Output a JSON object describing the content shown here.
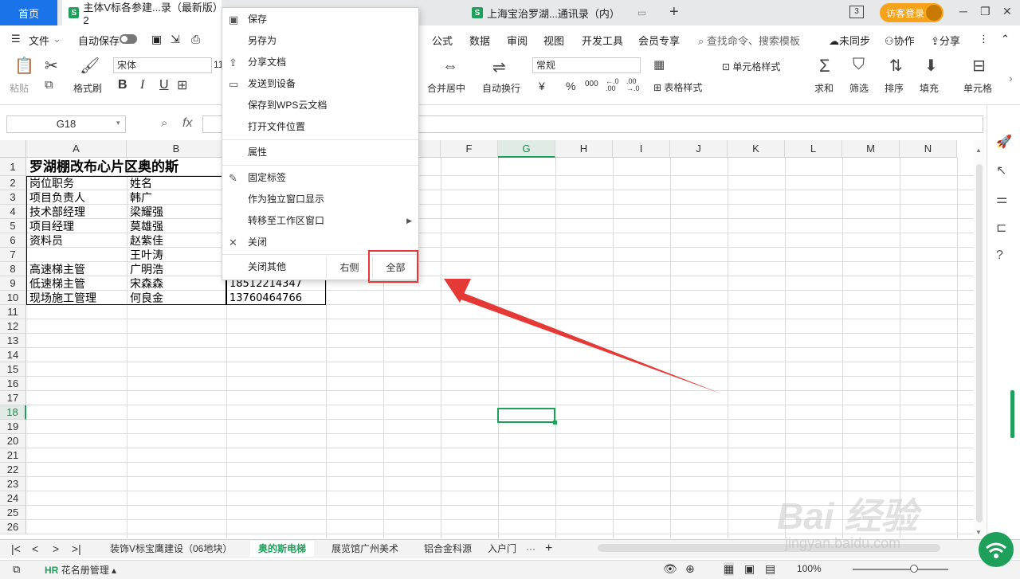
{
  "tabs": {
    "home": "首页",
    "doc1": "主体V标各参建...录（最新版）2",
    "doc2": "上海宝治罗湖...通讯录（内）",
    "new_tab": "+",
    "badge": "3",
    "visitor": "访客登录"
  },
  "menubar": {
    "file": "文件",
    "autosave": "自动保存",
    "items": [
      "公式",
      "数据",
      "审阅",
      "视图",
      "开发工具",
      "会员专享"
    ],
    "search": "查找命令、搜索模板",
    "unsync": "未同步",
    "collab": "协作",
    "share": "分享"
  },
  "ribbon": {
    "paste": "粘贴",
    "format_painter": "格式刷",
    "font_name": "宋体",
    "font_size": "11",
    "merge_center": "合并居中",
    "auto_wrap": "自动换行",
    "number_format": "常规",
    "cell_style": "单元格样式",
    "table_style": "表格样式",
    "sum": "求和",
    "filter": "筛选",
    "sort": "排序",
    "fill": "填充",
    "cell": "单元格",
    "bold": "B",
    "italic": "I",
    "underline": "U",
    "yuan": "¥",
    "percent": "%",
    "thousand": "000",
    "dec_inc": "←.0\n.00",
    "dec_dec": ".00\n→.0"
  },
  "formulabar": {
    "namebox": "G18",
    "fx": "fx",
    "content": ""
  },
  "grid": {
    "columns": [
      "A",
      "B",
      "C",
      "D",
      "E",
      "F",
      "G",
      "H",
      "I",
      "J",
      "K",
      "L",
      "M",
      "N"
    ],
    "rows": [
      "1",
      "2",
      "3",
      "4",
      "5",
      "6",
      "7",
      "8",
      "9",
      "10",
      "11",
      "12",
      "13",
      "14",
      "15",
      "16",
      "17",
      "18",
      "19",
      "20",
      "21",
      "22",
      "23",
      "24",
      "25",
      "26"
    ],
    "selected_col": "G",
    "selected_row": "18",
    "title": "罗湖棚改布心片区奥的斯",
    "cells": [
      {
        "a": "岗位职务",
        "b": "姓名",
        "c": ""
      },
      {
        "a": "项目负责人",
        "b": "韩广",
        "c": ""
      },
      {
        "a": "技术部经理",
        "b": "梁耀强",
        "c": ""
      },
      {
        "a": "项目经理",
        "b": "莫雄强",
        "c": ""
      },
      {
        "a": "资料员",
        "b": "赵紫佳",
        "c": ""
      },
      {
        "a": "",
        "b": "王叶涛",
        "c": ""
      },
      {
        "a": "高速梯主管",
        "b": "广明浩",
        "c": ""
      },
      {
        "a": "低速梯主管",
        "b": "宋森森",
        "c": "18512214347"
      },
      {
        "a": "现场施工管理",
        "b": "何良金",
        "c": "13760464766"
      }
    ]
  },
  "context_menu": {
    "save": "保存",
    "save_as": "另存为",
    "share_doc": "分享文档",
    "send_device": "发送到设备",
    "save_cloud": "保存到WPS云文档",
    "open_location": "打开文件位置",
    "properties": "属性",
    "pin_tab": "固定标签",
    "separate_window": "作为独立窗口显示",
    "move_workspace": "转移至工作区窗口",
    "close": "关闭",
    "close_others": "关闭其他",
    "right": "右侧",
    "all": "全部"
  },
  "sheets": {
    "tabs": [
      "装饰V标宝鹰建设（06地块）",
      "奥的斯电梯",
      "展览馆广州美术",
      "铝合金科源",
      "入户门"
    ],
    "active": "奥的斯电梯",
    "more": "···"
  },
  "status": {
    "roster": "花名册管理",
    "zoom": "100%"
  },
  "watermark": {
    "main": "Bai 经验",
    "url": "jingyan.baidu.com"
  },
  "colors": {
    "accent": "#1fa05a",
    "blue": "#1a73e8",
    "red": "#e53935",
    "orange": "#f7a21b"
  }
}
